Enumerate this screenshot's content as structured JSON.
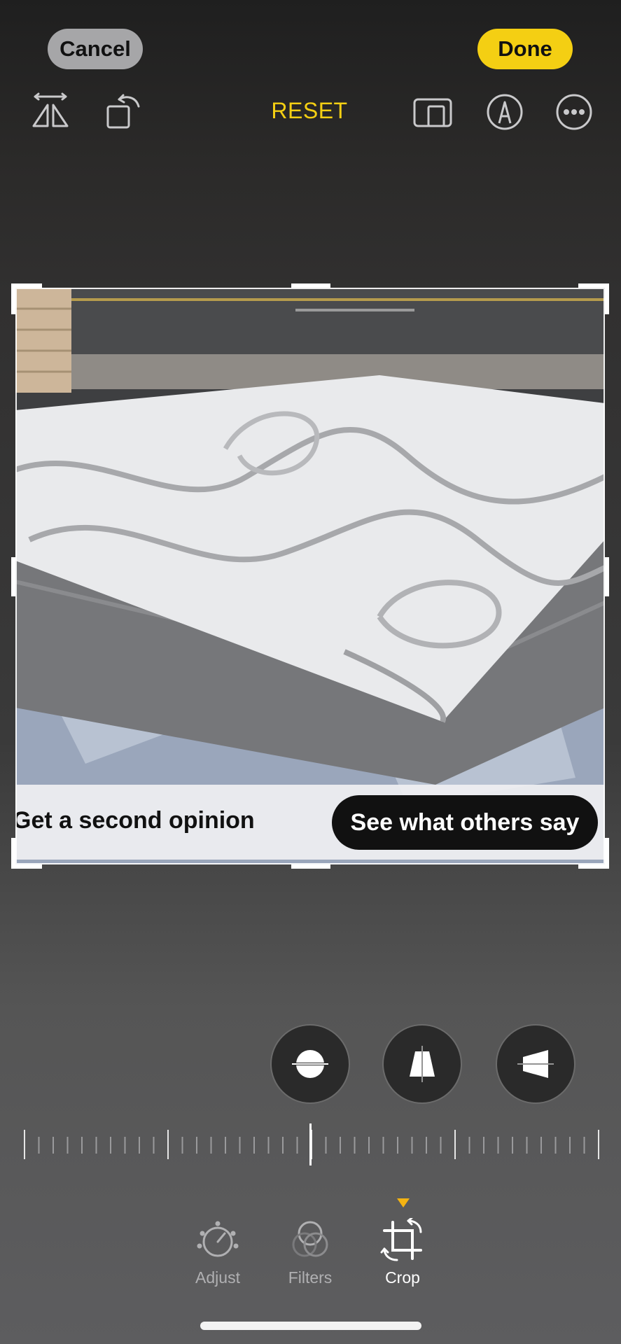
{
  "top_bar": {
    "cancel_label": "Cancel",
    "done_label": "Done",
    "reset_label": "RESET"
  },
  "photo_banner": {
    "text": "Get a second opinion",
    "cta_label": "See what others say"
  },
  "bottom_tabs": [
    {
      "label": "Adjust",
      "icon": "adjust-dial-icon",
      "selected": false
    },
    {
      "label": "Filters",
      "icon": "filters-circles-icon",
      "selected": false
    },
    {
      "label": "Crop",
      "icon": "crop-rotate-icon",
      "selected": true
    }
  ],
  "colors": {
    "accent": "#f4cf13",
    "cancel_bg": "#a6a6a8",
    "selected_marker": "#f4b312"
  }
}
